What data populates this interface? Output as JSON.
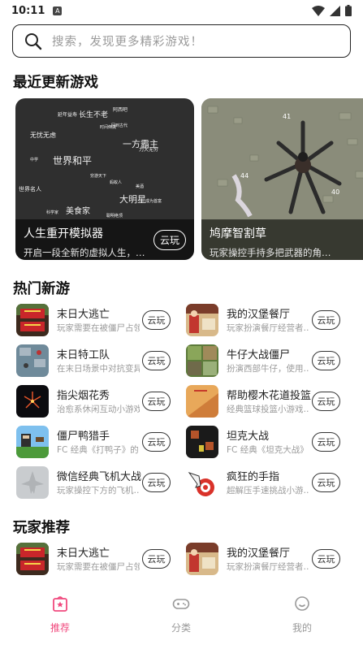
{
  "status_bar": {
    "time": "10:11",
    "notif": "A"
  },
  "search": {
    "placeholder": "搜索，发现更多精彩游戏！"
  },
  "recent_section": {
    "title": "最近更新游戏",
    "cards": [
      {
        "title": "人生重开模拟器",
        "desc": "开启一段全新的虚拟人生，…",
        "button": "云玩",
        "cloud_words": [
          "延年益寿",
          "长生不老",
          "阿西吧",
          "无忧无虑",
          "一方霸主",
          "回到古代",
          "中学",
          "世界和平",
          "力大无穷",
          "世界名人",
          "大明星",
          "美食家",
          "科学家",
          "美酒",
          "时间倒流",
          "成为首富",
          "穷游天下",
          "聪明绝顶",
          "蚂蚁人"
        ]
      },
      {
        "title": "鸠摩智割草",
        "desc": "玩家操控手持多把武器的角…",
        "button": "云",
        "numbers": [
          "44",
          "40",
          "41"
        ]
      }
    ]
  },
  "hot_section": {
    "title": "热门新游",
    "games": [
      {
        "name": "末日大逃亡",
        "desc": "玩家需要在被僵尸占领的城市",
        "button": "云玩",
        "icon": "zombie-escape"
      },
      {
        "name": "我的汉堡餐厅",
        "desc": "玩家扮演餐厅经营者…",
        "button": "云玩",
        "icon": "burger-restaurant"
      },
      {
        "name": "末日特工队",
        "desc": "在末日场景中对抗变异",
        "button": "云玩",
        "icon": "agents"
      },
      {
        "name": "牛仔大战僵尸",
        "desc": "扮演西部牛仔，使用…",
        "button": "云玩",
        "icon": "cowboy"
      },
      {
        "name": "指尖烟花秀",
        "desc": "治愈系休闲互动小游戏",
        "button": "云玩",
        "icon": "fireworks"
      },
      {
        "name": "帮助樱木花道投篮",
        "desc": "经典篮球投篮小游戏…",
        "button": "云玩",
        "icon": "basketball"
      },
      {
        "name": "僵尸鸭猎手",
        "desc": "FC 经典《打鸭子》的",
        "button": "云玩",
        "icon": "duck-hunter"
      },
      {
        "name": "坦克大战",
        "desc": "FC 经典《坦克大战》",
        "button": "云玩",
        "icon": "tank"
      },
      {
        "name": "微信经典飞机大战",
        "desc": "玩家操控下方的飞机…",
        "button": "云玩",
        "icon": "plane"
      },
      {
        "name": "疯狂的手指",
        "desc": "超解压手速挑战小游…",
        "button": "云玩",
        "icon": "finger"
      }
    ]
  },
  "player_section": {
    "title": "玩家推荐",
    "games": [
      {
        "name": "末日大逃亡",
        "desc": "玩家需要在被僵尸占领",
        "button": "云玩",
        "icon": "zombie-escape"
      },
      {
        "name": "我的汉堡餐厅",
        "desc": "玩家扮演餐厅经营者…",
        "button": "云玩",
        "icon": "burger-restaurant"
      }
    ]
  },
  "bottom_nav": {
    "tabs": [
      {
        "label": "推荐",
        "active": true
      },
      {
        "label": "分类",
        "active": false
      },
      {
        "label": "我的",
        "active": false
      }
    ]
  },
  "colors": {
    "accent": "#f04a7e",
    "text": "#222222",
    "muted": "#9b9b9b"
  }
}
